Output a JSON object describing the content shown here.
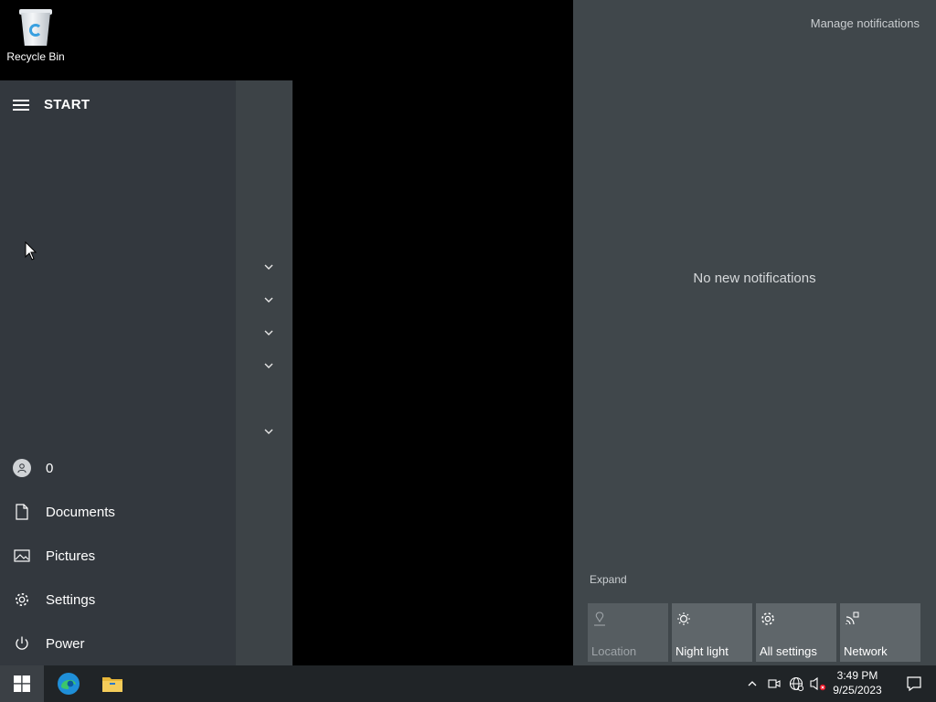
{
  "desktop": {
    "recycle_bin_label": "Recycle Bin"
  },
  "start_menu": {
    "title": "START",
    "user": {
      "label": "0"
    },
    "items": [
      {
        "label": "Documents",
        "icon": "document-icon"
      },
      {
        "label": "Pictures",
        "icon": "pictures-icon"
      },
      {
        "label": "Settings",
        "icon": "gear-icon"
      },
      {
        "label": "Power",
        "icon": "power-icon"
      }
    ]
  },
  "notifications": {
    "manage_label": "Manage notifications",
    "empty_label": "No new notifications",
    "expand_label": "Expand",
    "quick_actions": [
      {
        "label": "Location",
        "icon": "location-icon",
        "enabled": false
      },
      {
        "label": "Night light",
        "icon": "night-light-icon",
        "enabled": true
      },
      {
        "label": "All settings",
        "icon": "gear-icon",
        "enabled": true
      },
      {
        "label": "Network",
        "icon": "network-icon",
        "enabled": true
      }
    ]
  },
  "taskbar": {
    "time": "3:49 PM",
    "date": "9/25/2023"
  },
  "colors": {
    "start_bg": "#33383e",
    "notif_bg": "#40474b",
    "taskbar_bg": "#202427",
    "accent": "#0078d7"
  }
}
